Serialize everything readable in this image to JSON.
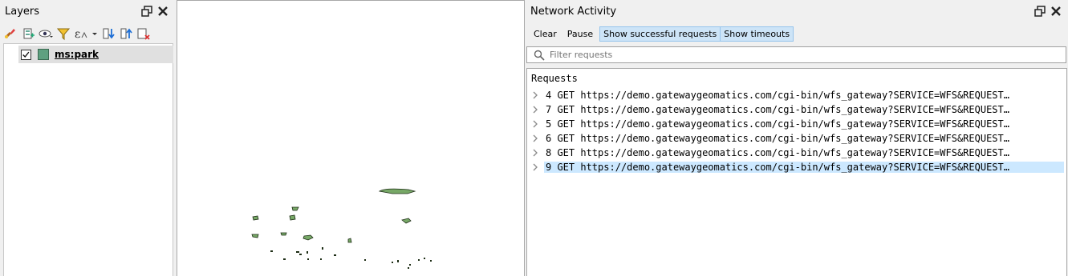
{
  "layers_panel": {
    "title": "Layers",
    "layer": {
      "name": "ms:park",
      "checked": true,
      "swatch_color": "#5fa080"
    }
  },
  "network_panel": {
    "title": "Network Activity",
    "toolbar": {
      "clear": "Clear",
      "pause": "Pause",
      "show_successful": "Show successful requests",
      "show_timeouts": "Show timeouts"
    },
    "filter_placeholder": "Filter requests",
    "requests_header": "Requests",
    "requests": [
      {
        "text": "4 GET https://demo.gatewaygeomatics.com/cgi-bin/wfs_gateway?SERVICE=WFS&REQUEST…",
        "selected": false
      },
      {
        "text": "7 GET https://demo.gatewaygeomatics.com/cgi-bin/wfs_gateway?SERVICE=WFS&REQUEST…",
        "selected": false
      },
      {
        "text": "5 GET https://demo.gatewaygeomatics.com/cgi-bin/wfs_gateway?SERVICE=WFS&REQUEST…",
        "selected": false
      },
      {
        "text": "6 GET https://demo.gatewaygeomatics.com/cgi-bin/wfs_gateway?SERVICE=WFS&REQUEST…",
        "selected": false
      },
      {
        "text": "8 GET https://demo.gatewaygeomatics.com/cgi-bin/wfs_gateway?SERVICE=WFS&REQUEST…",
        "selected": false
      },
      {
        "text": "9 GET https://demo.gatewaygeomatics.com/cgi-bin/wfs_gateway?SERVICE=WFS&REQUEST…",
        "selected": true
      }
    ]
  },
  "colors": {
    "park_fill": "#77a867",
    "selection": "#cce8ff",
    "toggle_active": "#cde4f7"
  }
}
